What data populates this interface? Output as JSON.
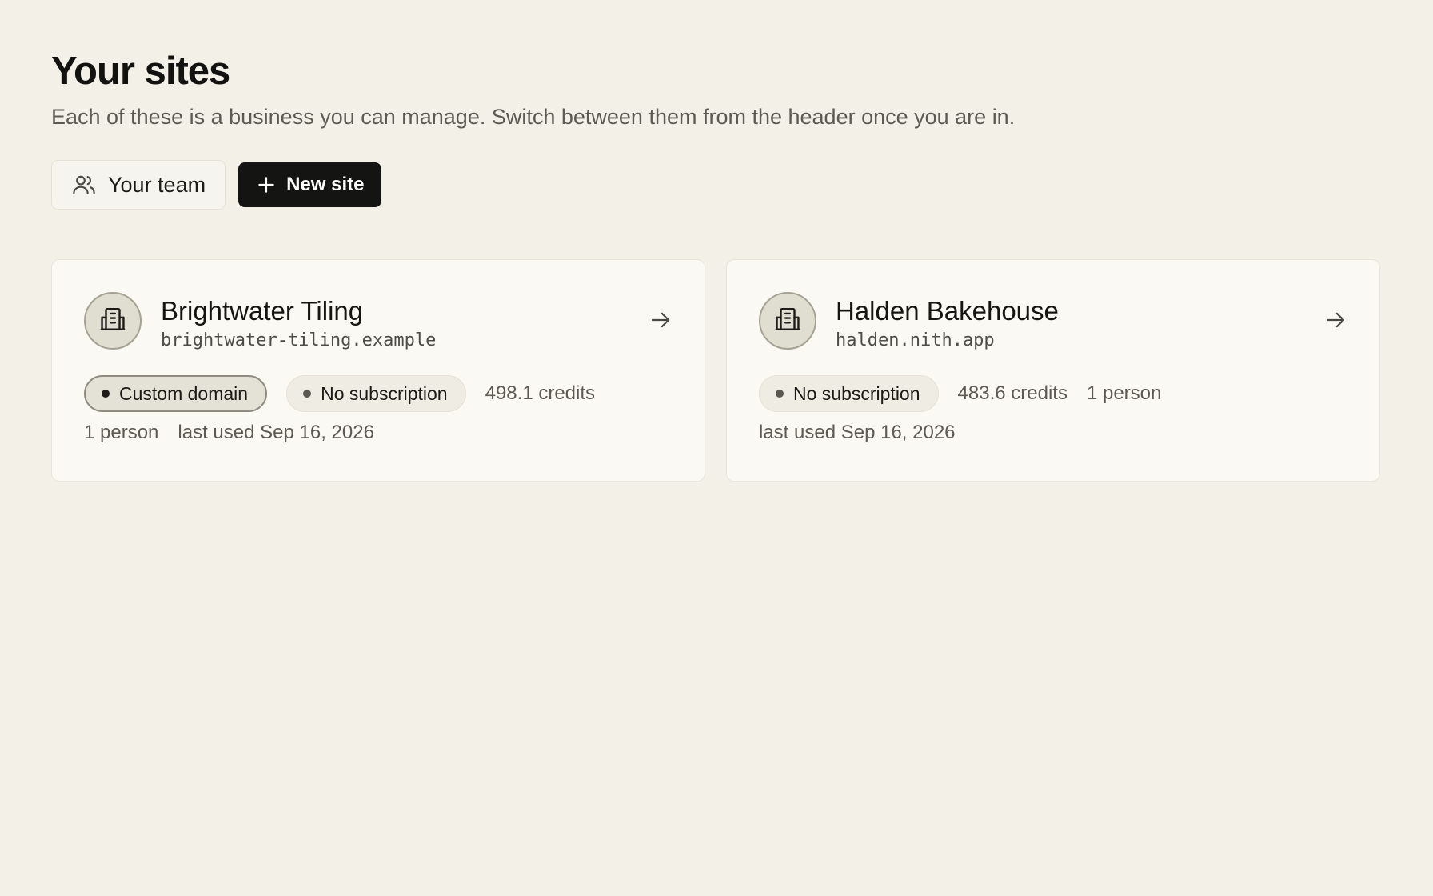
{
  "header": {
    "title": "Your sites",
    "subtitle": "Each of these is a business you can manage. Switch between them from the header once you are in."
  },
  "actions": {
    "team_label": "Your team",
    "new_site_label": "New site"
  },
  "sites": [
    {
      "name": "Brightwater Tiling",
      "domain": "brightwater-tiling.example",
      "badges": [
        "Custom domain",
        "No subscription"
      ],
      "credits": "498.1 credits",
      "people": "1 person",
      "last_used": "last used Sep 16, 2026"
    },
    {
      "name": "Halden Bakehouse",
      "domain": "halden.nith.app",
      "badges": [
        "No subscription"
      ],
      "credits": "483.6 credits",
      "people": "1 person",
      "last_used": "last used Sep 16, 2026"
    }
  ],
  "icons": {
    "team": "users-icon",
    "new": "plus-icon",
    "site": "building-icon",
    "open": "arrow-right-icon"
  },
  "colors": {
    "background": "#f3f0e8",
    "card": "#faf9f3",
    "primary_button": "#141412",
    "muted_text": "#5d5a53"
  }
}
